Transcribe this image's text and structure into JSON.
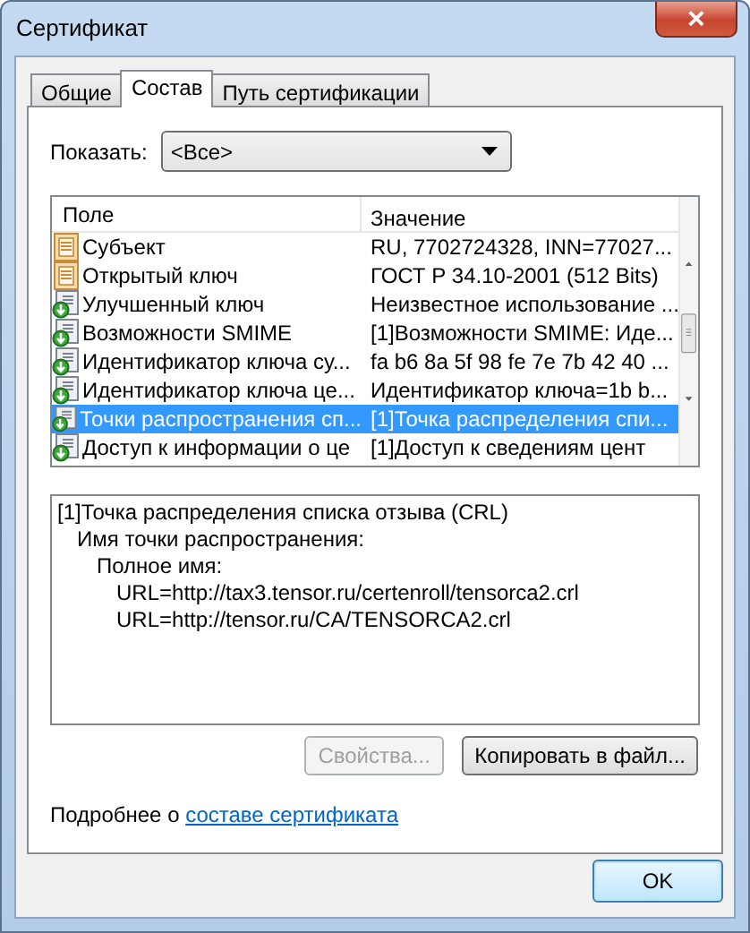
{
  "window": {
    "title": "Сертификат",
    "close": "×"
  },
  "tabs": [
    {
      "label": "Общие",
      "selected": false
    },
    {
      "label": "Состав",
      "selected": true
    },
    {
      "label": "Путь сертификации",
      "selected": false
    }
  ],
  "show": {
    "label": "Показать:",
    "value": "<Все>"
  },
  "table": {
    "columns": [
      "Поле",
      "Значение"
    ],
    "rows": [
      {
        "kind": "field",
        "field": "Субъект",
        "value": "RU, 7702724328, INN=77027...",
        "selected": false
      },
      {
        "kind": "field",
        "field": "Открытый ключ",
        "value": "ГОСТ Р 34.10-2001 (512 Bits)",
        "selected": false
      },
      {
        "kind": "extension",
        "field": "Улучшенный ключ",
        "value": "Неизвестное использование ...",
        "selected": false
      },
      {
        "kind": "extension",
        "field": "Возможности SMIME",
        "value": "[1]Возможности SMIME: Иде...",
        "selected": false
      },
      {
        "kind": "extension",
        "field": "Идентификатор ключа су...",
        "value": "fa b6 8a 5f 98 fe 7e 7b 42 40 ...",
        "selected": false
      },
      {
        "kind": "extension",
        "field": "Идентификатор ключа це...",
        "value": "Идентификатор ключа=1b b...",
        "selected": false
      },
      {
        "kind": "extension",
        "field": "Точки распространения сп...",
        "value": "[1]Точка распределения спи...",
        "selected": true
      },
      {
        "kind": "extension",
        "field": "Доступ к информации о це",
        "value": "[1]Доступ к сведениям цент",
        "selected": false
      }
    ]
  },
  "details": [
    {
      "text": "[1]Точка распределения списка отзыва (CRL)",
      "children": [
        {
          "text": "Имя точки распространения:",
          "children": [
            {
              "text": "Полное имя:",
              "children": [
                {
                  "text": "URL=http://tax3.tensor.ru/certenroll/tensorca2.crl"
                },
                {
                  "text": "URL=http://tensor.ru/CA/TENSORCA2.crl"
                }
              ]
            }
          ]
        }
      ]
    }
  ],
  "buttons": [
    {
      "label": "Свойства...",
      "disabled": true
    },
    {
      "label": "Копировать в файл...",
      "disabled": false
    }
  ],
  "more": {
    "text": "Подробнее о",
    "link": "составе сертификата"
  },
  "ok": "OK"
}
